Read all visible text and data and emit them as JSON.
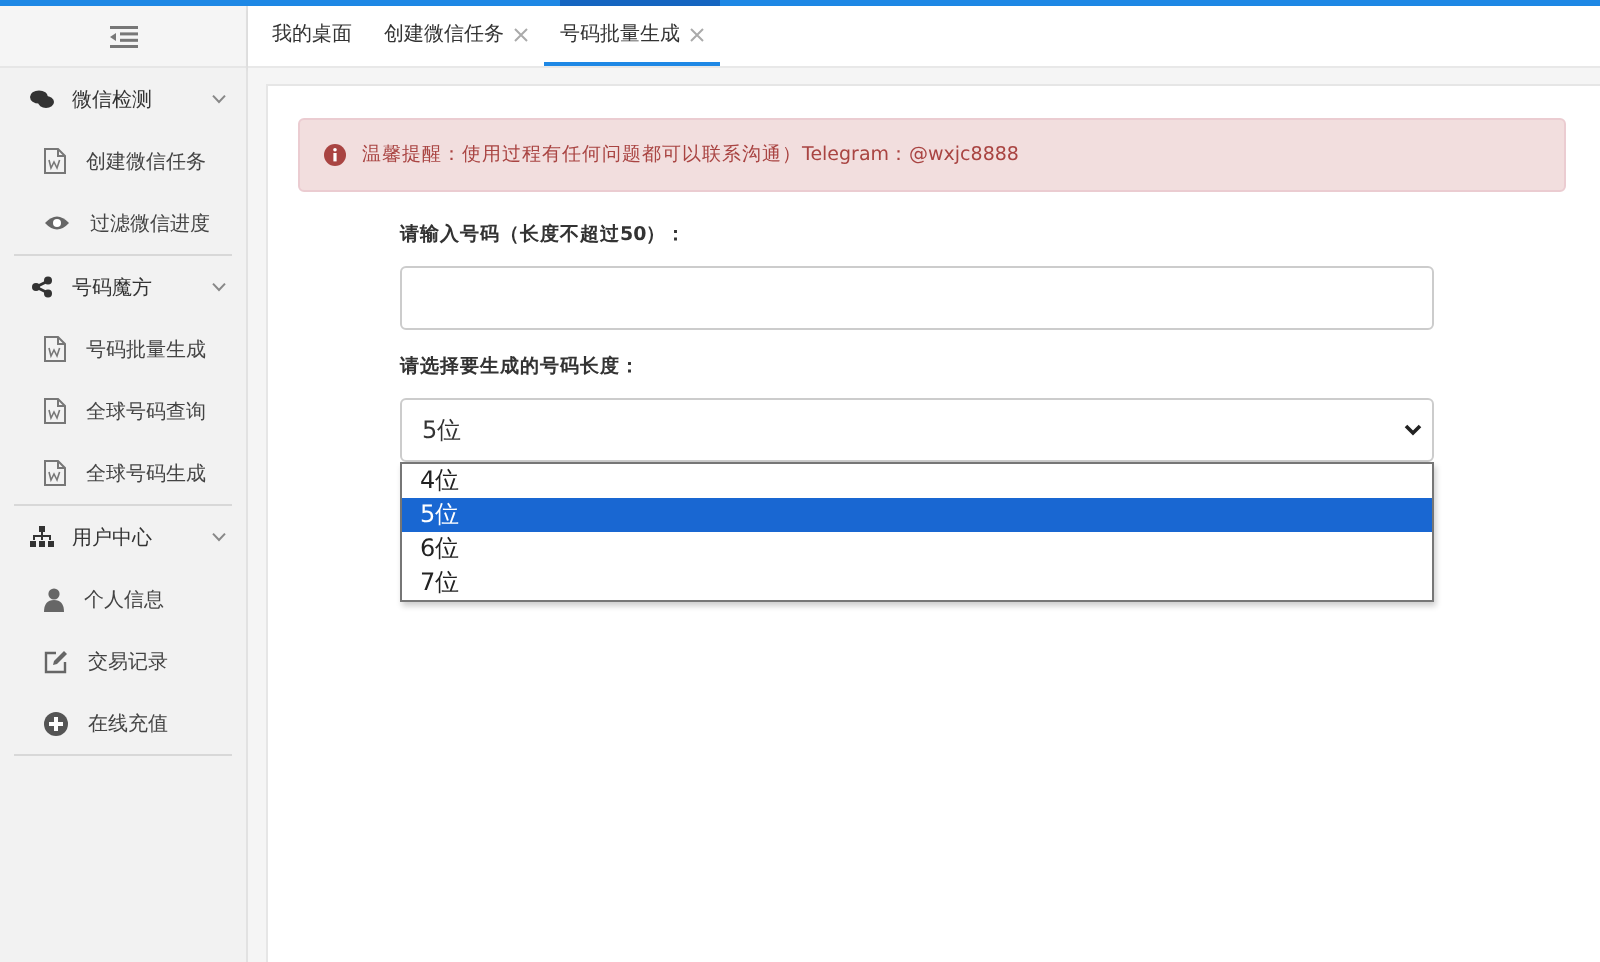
{
  "sidebar": {
    "groups": [
      {
        "label": "微信检测",
        "expanded": true,
        "children": [
          {
            "label": "创建微信任务"
          },
          {
            "label": "过滤微信进度"
          }
        ]
      },
      {
        "label": "号码魔方",
        "expanded": true,
        "children": [
          {
            "label": "号码批量生成"
          },
          {
            "label": "全球号码查询"
          },
          {
            "label": "全球号码生成"
          }
        ]
      },
      {
        "label": "用户中心",
        "expanded": true,
        "children": [
          {
            "label": "个人信息"
          },
          {
            "label": "交易记录"
          },
          {
            "label": "在线充值"
          }
        ]
      }
    ]
  },
  "tabs": [
    {
      "label": "我的桌面",
      "closable": false,
      "selected": false
    },
    {
      "label": "创建微信任务",
      "closable": true,
      "selected": false
    },
    {
      "label": "号码批量生成",
      "closable": true,
      "selected": true
    }
  ],
  "alert": {
    "text": "温馨提醒：使用过程有任何问题都可以联系沟通）Telegram：@wxjc8888"
  },
  "form": {
    "number_label": "请输入号码（长度不超过50）：",
    "length_label": "请选择要生成的号码长度：",
    "length_value": "5位",
    "options": [
      {
        "label": "4位",
        "selected": false
      },
      {
        "label": "5位",
        "selected": true
      },
      {
        "label": "6位",
        "selected": false
      },
      {
        "label": "7位",
        "selected": false
      }
    ]
  }
}
